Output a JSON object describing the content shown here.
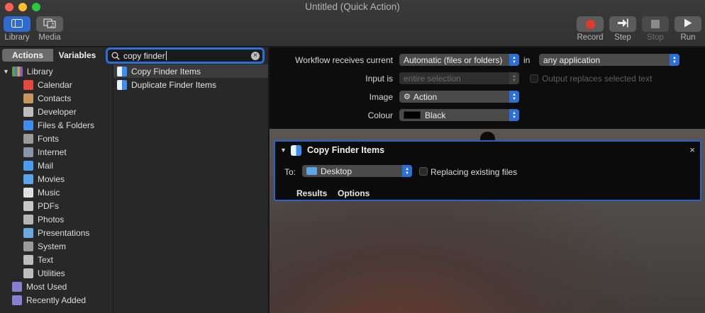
{
  "window": {
    "title": "Untitled (Quick Action)"
  },
  "toolbar": {
    "library_label": "Library",
    "media_label": "Media",
    "record_label": "Record",
    "step_label": "Step",
    "stop_label": "Stop",
    "run_label": "Run"
  },
  "left": {
    "tab_actions": "Actions",
    "tab_variables": "Variables",
    "search_value": "copy finder",
    "library_root": "Library",
    "categories": [
      {
        "label": "Calendar",
        "icon": "calendar-icon",
        "color": "#e64a3c"
      },
      {
        "label": "Contacts",
        "icon": "contacts-icon",
        "color": "#c8955a"
      },
      {
        "label": "Developer",
        "icon": "developer-tools-icon",
        "color": "#bdbdbd"
      },
      {
        "label": "Files & Folders",
        "icon": "finder-icon",
        "color": "#3d8ef0"
      },
      {
        "label": "Fonts",
        "icon": "fonts-icon",
        "color": "#9a9a9a"
      },
      {
        "label": "Internet",
        "icon": "internet-globe-icon",
        "color": "#8a95a6"
      },
      {
        "label": "Mail",
        "icon": "mail-icon",
        "color": "#4a9cf0"
      },
      {
        "label": "Movies",
        "icon": "movies-icon",
        "color": "#5aa6e8"
      },
      {
        "label": "Music",
        "icon": "music-icon",
        "color": "#e0e0e0"
      },
      {
        "label": "PDFs",
        "icon": "pdf-icon",
        "color": "#c8c8c8"
      },
      {
        "label": "Photos",
        "icon": "photos-icon",
        "color": "#b5b5b5"
      },
      {
        "label": "Presentations",
        "icon": "presentations-icon",
        "color": "#6aa8e0"
      },
      {
        "label": "System",
        "icon": "system-icon",
        "color": "#9a9a9a"
      },
      {
        "label": "Text",
        "icon": "text-icon",
        "color": "#bdbdbd"
      },
      {
        "label": "Utilities",
        "icon": "utilities-icon",
        "color": "#bdbdbd"
      }
    ],
    "most_used": "Most Used",
    "recently_added": "Recently Added",
    "results": [
      {
        "label": "Copy Finder Items",
        "selected": true
      },
      {
        "label": "Duplicate Finder Items",
        "selected": false
      }
    ]
  },
  "workflow": {
    "receives_label": "Workflow receives current",
    "receives_value": "Automatic (files or folders)",
    "in_label": "in",
    "app_value": "any application",
    "input_is_label": "Input is",
    "input_is_value": "entire selection",
    "output_replaces_label": "Output replaces selected text",
    "image_label": "Image",
    "image_value": "Action",
    "colour_label": "Colour",
    "colour_value": "Black",
    "colour_swatch": "#000000"
  },
  "action": {
    "title": "Copy Finder Items",
    "to_label": "To:",
    "to_value": "Desktop",
    "replacing_label": "Replacing existing files",
    "results_tab": "Results",
    "options_tab": "Options"
  },
  "colors": {
    "accent": "#2c6fd6",
    "record": "#e0392f"
  }
}
